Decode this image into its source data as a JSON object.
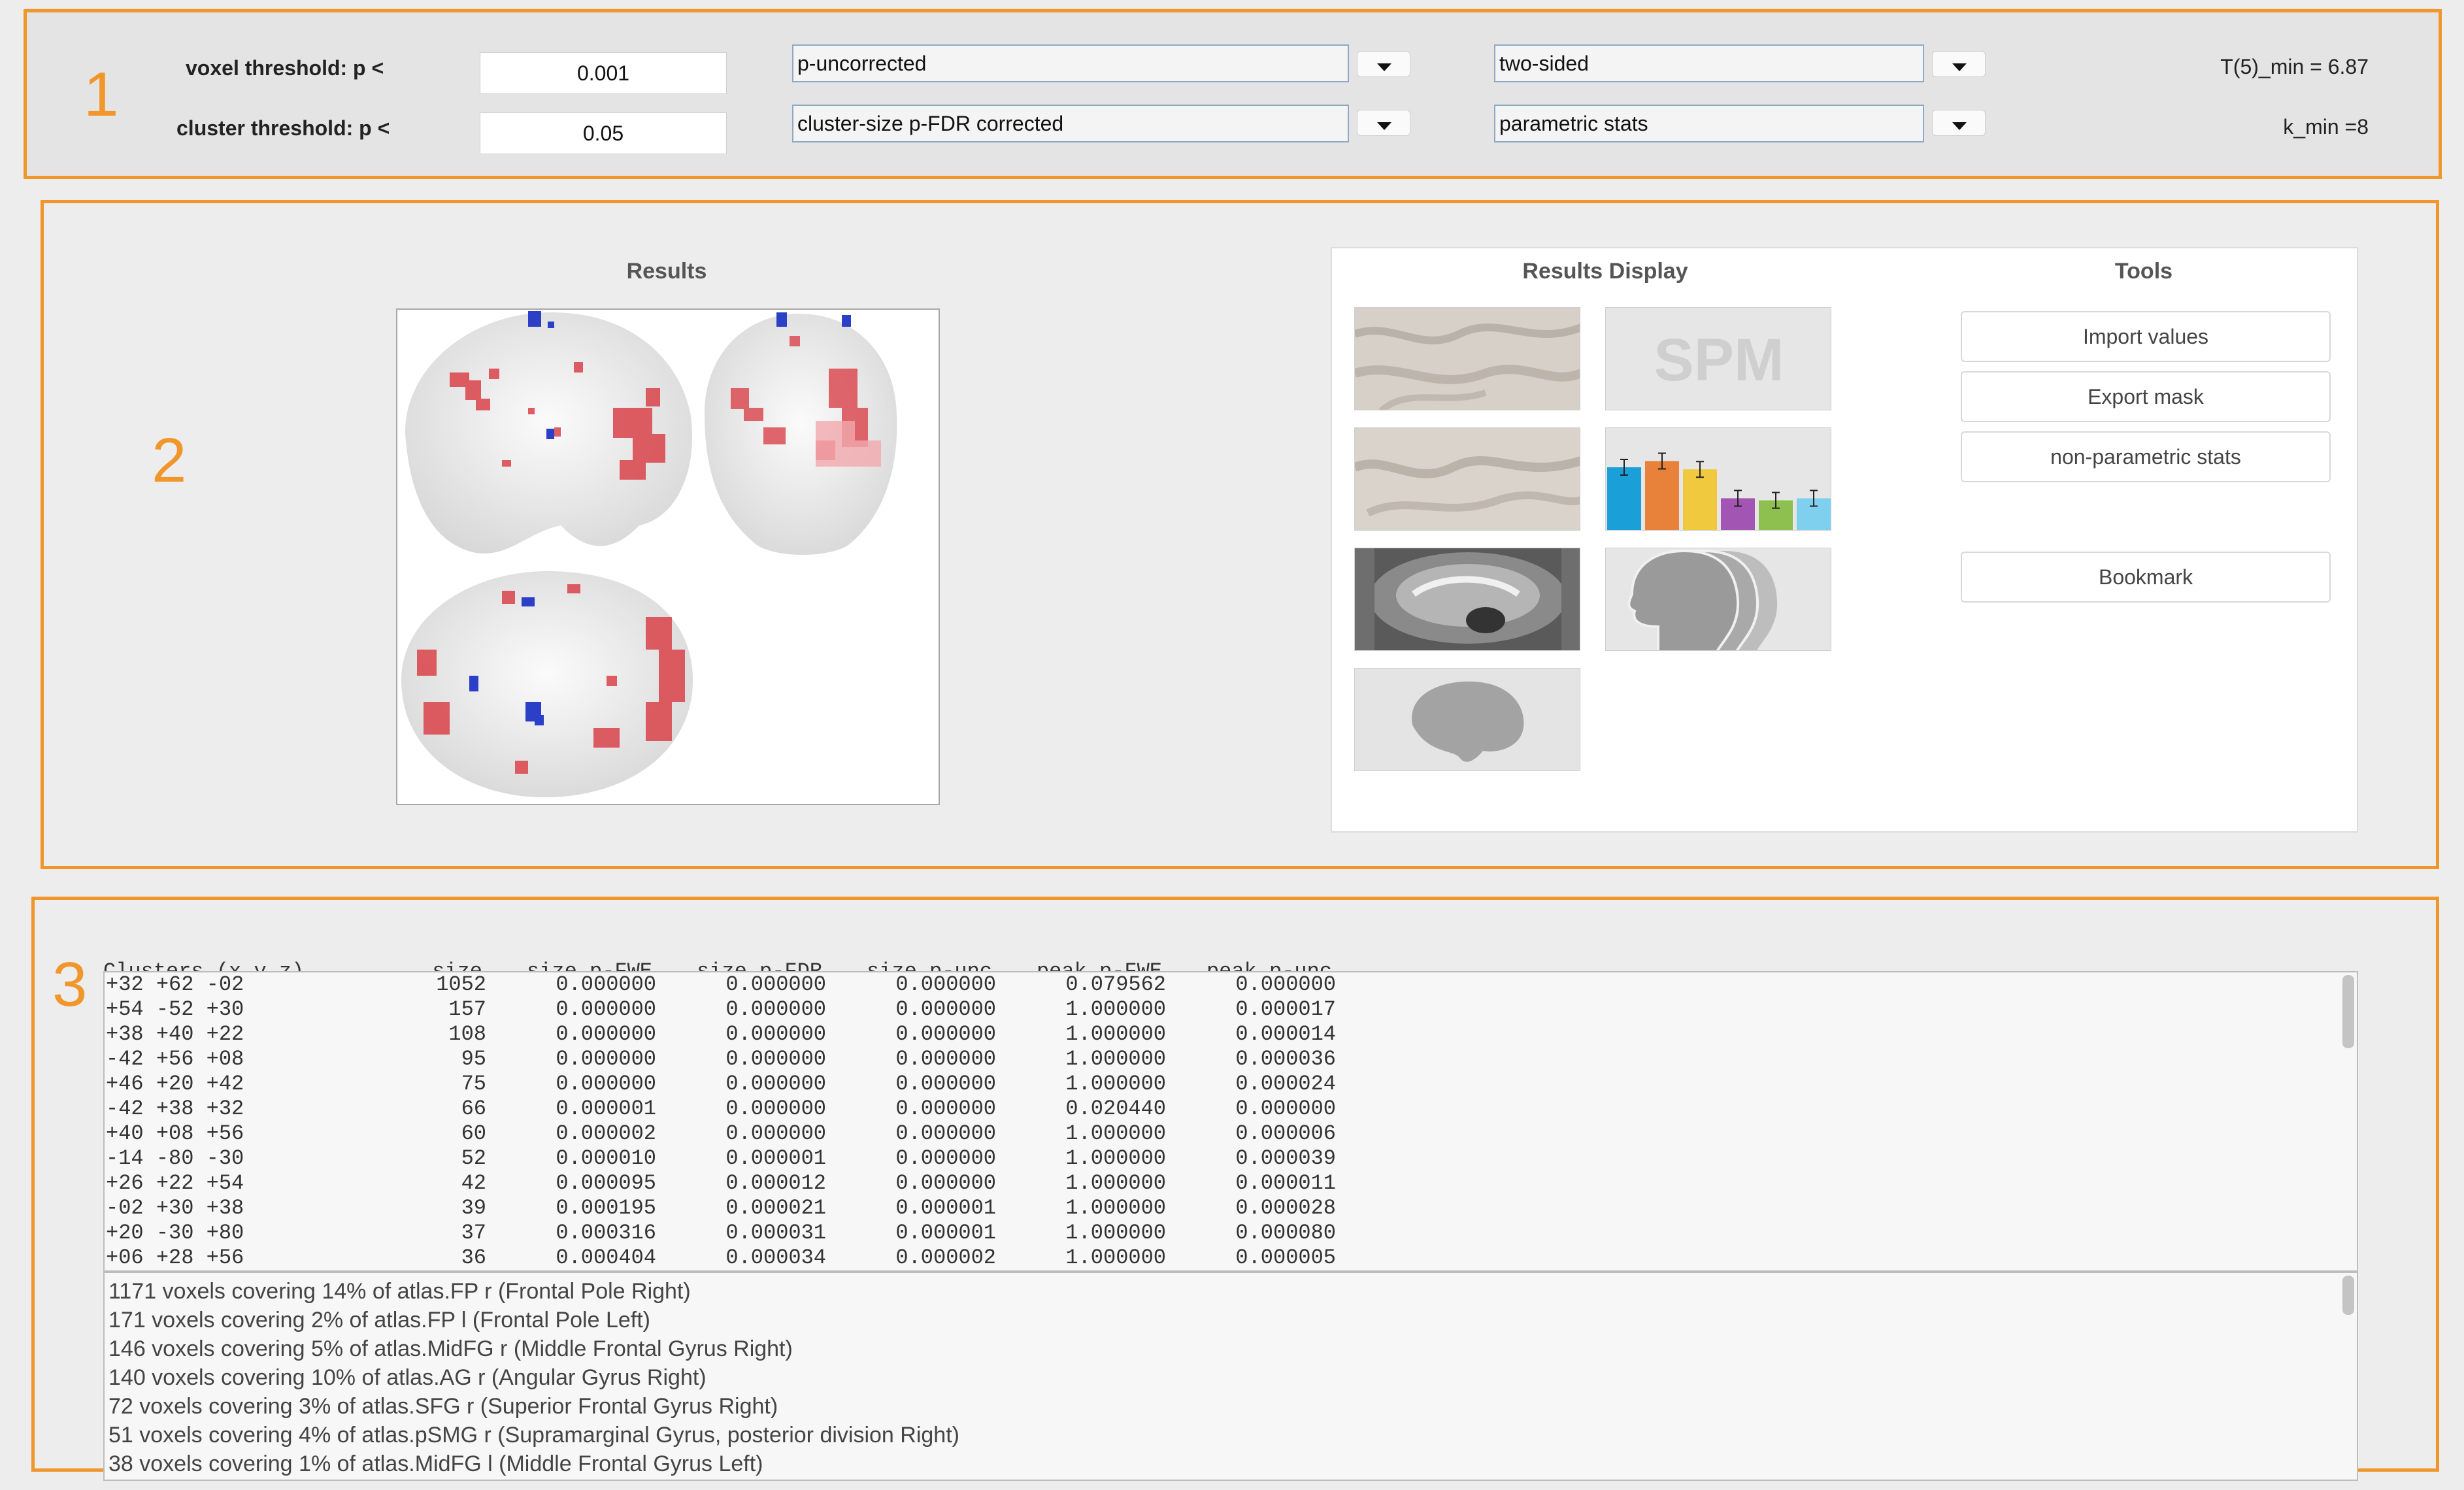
{
  "settings": {
    "section_number": "1",
    "voxel_label": "voxel threshold: p <",
    "voxel_value": "0.001",
    "cluster_label": "cluster threshold: p <",
    "cluster_value": "0.05",
    "voxel_correction": "p-uncorrected",
    "cluster_correction": "cluster-size p-FDR corrected",
    "sidedness": "two-sided",
    "stats_type": "parametric stats",
    "t_min": "T(5)_min = 6.87",
    "k_min": "k_min =8"
  },
  "results": {
    "section_number": "2",
    "title": "Results",
    "display_title": "Results Display",
    "tools_title": "Tools",
    "spm_logo_text": "SPM",
    "tools": [
      "Import values",
      "Export mask",
      "non-parametric stats",
      "Bookmark"
    ],
    "bar_colors": [
      "#1a9fd8",
      "#e8823a",
      "#f0c93f",
      "#a355b3",
      "#8dc04f",
      "#7fd0ee"
    ],
    "bar_levels": [
      0.62,
      0.68,
      0.6,
      0.32,
      0.3,
      0.32
    ]
  },
  "clusters": {
    "section_number": "3",
    "headers": [
      "Clusters (x,y,z)",
      "size",
      "size p-FWE",
      "size p-FDR",
      "size p-unc",
      "peak p-FWE",
      "peak p-unc"
    ],
    "rows": [
      [
        "+32 +62 -02",
        "1052",
        "0.000000",
        "0.000000",
        "0.000000",
        "0.079562",
        "0.000000"
      ],
      [
        "+54 -52 +30",
        "157",
        "0.000000",
        "0.000000",
        "0.000000",
        "1.000000",
        "0.000017"
      ],
      [
        "+38 +40 +22",
        "108",
        "0.000000",
        "0.000000",
        "0.000000",
        "1.000000",
        "0.000014"
      ],
      [
        "-42 +56 +08",
        "95",
        "0.000000",
        "0.000000",
        "0.000000",
        "1.000000",
        "0.000036"
      ],
      [
        "+46 +20 +42",
        "75",
        "0.000000",
        "0.000000",
        "0.000000",
        "1.000000",
        "0.000024"
      ],
      [
        "-42 +38 +32",
        "66",
        "0.000001",
        "0.000000",
        "0.000000",
        "0.020440",
        "0.000000"
      ],
      [
        "+40 +08 +56",
        "60",
        "0.000002",
        "0.000000",
        "0.000000",
        "1.000000",
        "0.000006"
      ],
      [
        "-14 -80 -30",
        "52",
        "0.000010",
        "0.000001",
        "0.000000",
        "1.000000",
        "0.000039"
      ],
      [
        "+26 +22 +54",
        "42",
        "0.000095",
        "0.000012",
        "0.000000",
        "1.000000",
        "0.000011"
      ],
      [
        "-02 +30 +38",
        "39",
        "0.000195",
        "0.000021",
        "0.000001",
        "1.000000",
        "0.000028"
      ],
      [
        "+20 -30 +80",
        "37",
        "0.000316",
        "0.000031",
        "0.000001",
        "1.000000",
        "0.000080"
      ],
      [
        "+06 +28 +56",
        "36",
        "0.000404",
        "0.000034",
        "0.000002",
        "1.000000",
        "0.000005"
      ]
    ],
    "atlas_lines": [
      "1171 voxels covering 14% of atlas.FP r (Frontal Pole Right)",
      "171 voxels covering 2% of atlas.FP l (Frontal Pole Left)",
      "146 voxels covering 5% of atlas.MidFG r (Middle Frontal Gyrus Right)",
      "140 voxels covering 10% of atlas.AG r (Angular Gyrus Right)",
      "72 voxels covering 3% of atlas.SFG r (Superior Frontal Gyrus Right)",
      "51 voxels covering 4% of atlas.pSMG r (Supramarginal Gyrus, posterior division Right)",
      "38 voxels covering 1% of atlas.MidFG l (Middle Frontal Gyrus Left)"
    ]
  },
  "colors": {
    "highlight": "#f0962a",
    "activation_positive": "#d9434a",
    "activation_negative": "#2b3fc7"
  }
}
